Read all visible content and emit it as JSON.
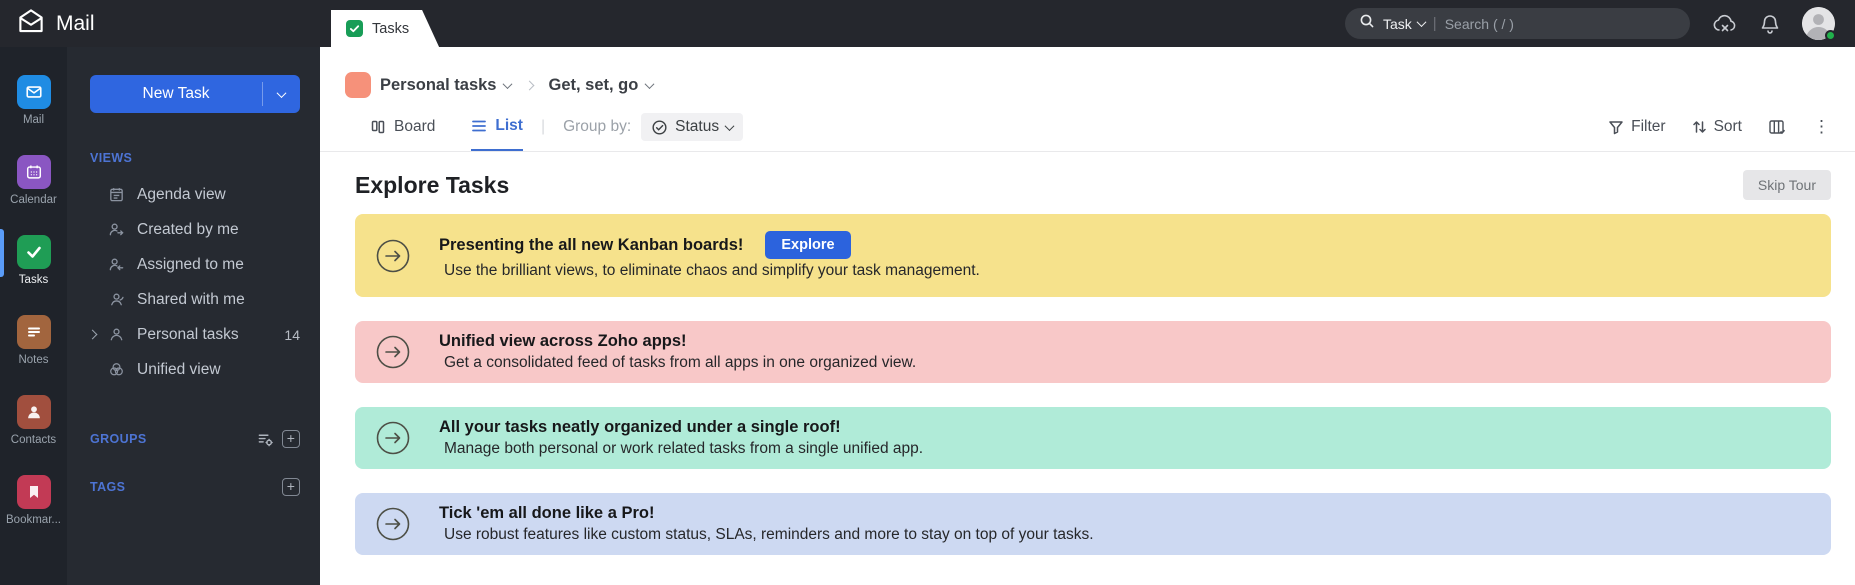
{
  "app": {
    "brand": "Mail"
  },
  "topbar": {
    "tab_label": "Tasks",
    "search": {
      "scope": "Task",
      "placeholder": "Search ( / )"
    }
  },
  "rail": {
    "items": [
      {
        "label": "Mail",
        "color": "#1f8ce3"
      },
      {
        "label": "Calendar",
        "color": "#8a56c2"
      },
      {
        "label": "Tasks",
        "color": "#1f9d55"
      },
      {
        "label": "Notes",
        "color": "#a2653e"
      },
      {
        "label": "Contacts",
        "color": "#a14f3e"
      },
      {
        "label": "Bookmar...",
        "color": "#c23a55"
      }
    ]
  },
  "sidebar": {
    "new_task_label": "New Task",
    "views_header": "VIEWS",
    "views": [
      {
        "label": "Agenda view"
      },
      {
        "label": "Created by me"
      },
      {
        "label": "Assigned to me"
      },
      {
        "label": "Shared with me"
      },
      {
        "label": "Personal tasks",
        "count": "14"
      },
      {
        "label": "Unified view"
      }
    ],
    "groups_header": "GROUPS",
    "tags_header": "TAGS"
  },
  "breadcrumb": {
    "project": "Personal tasks",
    "section": "Get, set, go",
    "swatch_color": "#f6917a"
  },
  "toolbar": {
    "board_label": "Board",
    "list_label": "List",
    "group_by_label": "Group by:",
    "group_by_value": "Status",
    "filter_label": "Filter",
    "sort_label": "Sort"
  },
  "main": {
    "title": "Explore Tasks",
    "skip_tour_label": "Skip Tour",
    "accent_color": "#2c63dd",
    "banners": [
      {
        "title": "Presenting the all new Kanban boards!",
        "subtitle": "Use the brilliant views, to eliminate chaos and simplify your task management.",
        "button_label": "Explore",
        "bg": "#f6e28c"
      },
      {
        "title": "Unified view across Zoho apps!",
        "subtitle": "Get a consolidated feed of tasks from all apps in one organized view.",
        "bg": "#f8c8c8"
      },
      {
        "title": "All your tasks neatly organized under a single roof!",
        "subtitle": "Manage both personal or work related tasks from a single unified app.",
        "bg": "#b0ebd8"
      },
      {
        "title": "Tick 'em all done like a Pro!",
        "subtitle": "Use robust features like custom status, SLAs, reminders and more to stay on top of your tasks.",
        "bg": "#cdd9f2"
      }
    ]
  }
}
